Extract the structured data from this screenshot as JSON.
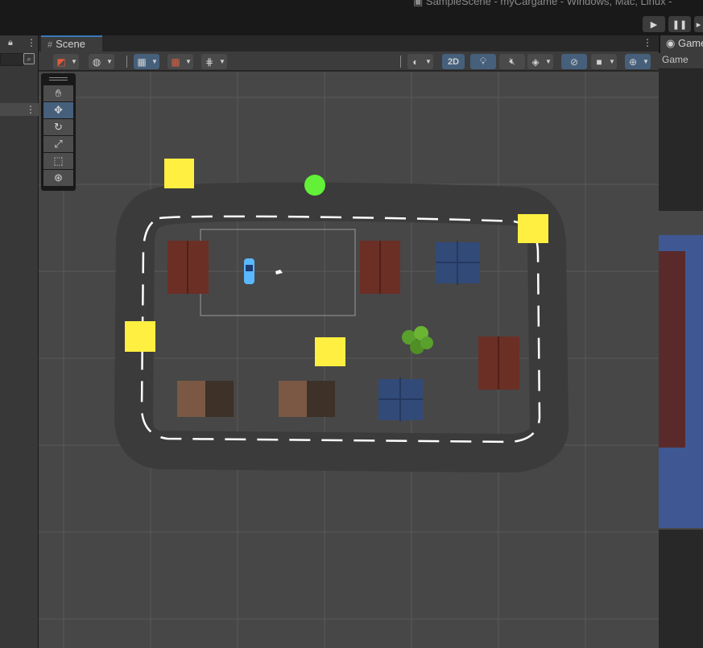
{
  "window": {
    "title": "SampleScene - myCargame - Windows, Mac, Linux -"
  },
  "playmode": {
    "play_icon": "play-icon",
    "pause_icon": "pause-icon",
    "step_icon": "step-icon"
  },
  "hierarchy": {
    "lock_icon": "lock-icon",
    "menu_icon": "kebab-icon"
  },
  "scene_panel": {
    "tab_label": "Scene",
    "toolbar": {
      "mode_2d_label": "2D"
    },
    "tools": [
      "hand-tool-icon",
      "move-tool-icon",
      "rotate-tool-icon",
      "scale-tool-icon",
      "rect-tool-icon",
      "transform-tool-icon"
    ],
    "active_tool": "move-tool-icon"
  },
  "game_panel": {
    "tab_label": "Game",
    "view_label": "Game"
  },
  "scene": {
    "colors": {
      "background": "#474747",
      "track": "#3b3b3b",
      "lane_marks": "#ffffff",
      "checkpoint": "#ffef40",
      "pickup": "#63f038",
      "house_red": "#6b2f25",
      "house_blue": "#324a78",
      "house_brown": "#7a5843",
      "tree": "#5aa02c",
      "car": "#5ab8ff"
    }
  }
}
